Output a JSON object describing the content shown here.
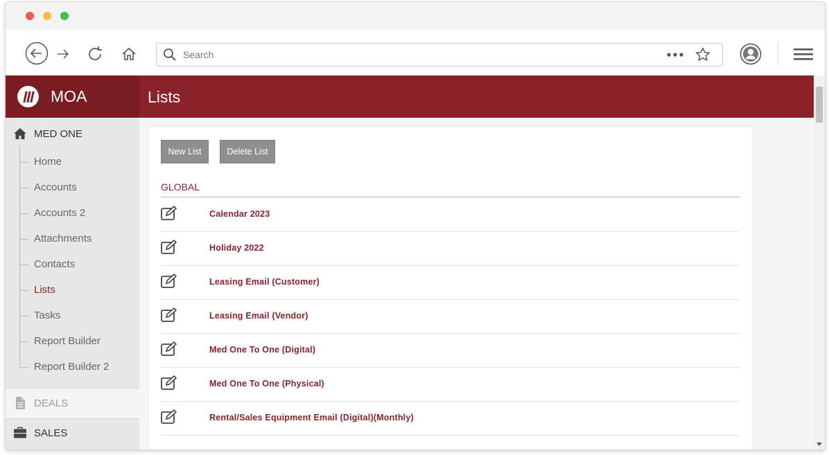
{
  "browser": {
    "search_placeholder": "Search",
    "icons": [
      "back-icon",
      "forward-icon",
      "reload-icon",
      "home-icon",
      "search-icon",
      "more-icon",
      "star-icon",
      "profile-icon",
      "hamburger-menu-icon"
    ]
  },
  "app": {
    "brand_name": "MOA",
    "page_title": "Lists",
    "accent_color": "#8b2229"
  },
  "sidebar": {
    "group_main": "MED ONE",
    "items": [
      {
        "label": "Home"
      },
      {
        "label": "Accounts"
      },
      {
        "label": "Accounts 2"
      },
      {
        "label": "Attachments"
      },
      {
        "label": "Contacts"
      },
      {
        "label": "Lists",
        "active": true
      },
      {
        "label": "Tasks"
      },
      {
        "label": "Report Builder"
      },
      {
        "label": "Report Builder 2"
      }
    ],
    "group_deals": "DEALS",
    "group_sales": "SALES"
  },
  "content": {
    "new_list_label": "New List",
    "delete_list_label": "Delete List",
    "section_label": "GLOBAL",
    "lists": [
      {
        "name": "Calendar 2023"
      },
      {
        "name": "Holiday 2022"
      },
      {
        "name": "Leasing Email (Customer)"
      },
      {
        "name": "Leasing Email (Vendor)"
      },
      {
        "name": "Med One To One (Digital)"
      },
      {
        "name": "Med One To One (Physical)"
      },
      {
        "name": "Rental/Sales Equipment Email (Digital)(Monthly)"
      }
    ]
  }
}
